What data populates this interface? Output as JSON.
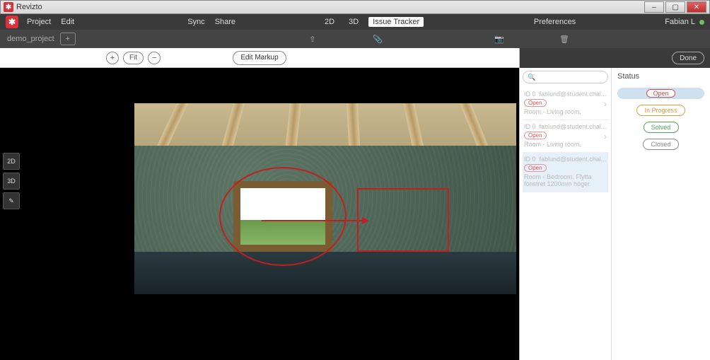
{
  "window": {
    "title": "Revizto"
  },
  "menu": {
    "project": "Project",
    "edit": "Edit",
    "sync": "Sync",
    "share": "Share",
    "tabs": {
      "t2d": "2D",
      "t3d": "3D",
      "issue": "Issue Tracker"
    },
    "prefs": "Preferences",
    "user": "Fabian L"
  },
  "toolbar": {
    "project_name": "demo_project"
  },
  "markup": {
    "plus": "+",
    "fit": "Fit",
    "minus": "−",
    "edit_markup": "Edit Markup",
    "done": "Done"
  },
  "lefttools": {
    "t2d": "2D",
    "t3d": "3D",
    "brush": "✎"
  },
  "search": {
    "placeholder": "",
    "icon": "🔍"
  },
  "issues": [
    {
      "id": "ID 0",
      "user": "fablund@student.chal...",
      "status": "Open",
      "loc": "Room - Living room,"
    },
    {
      "id": "ID 0",
      "user": "fablund@student.chal...",
      "status": "Open",
      "loc": "Room - Living room,"
    },
    {
      "id": "ID 0",
      "user": "fablund@student.chal...",
      "status": "Open",
      "loc": "Room - Bedroom. Flytta fönstret 1200mm höger"
    }
  ],
  "status": {
    "header": "Status",
    "open": "Open",
    "in_progress": "In Progress",
    "solved": "Solved",
    "closed": "Closed"
  }
}
